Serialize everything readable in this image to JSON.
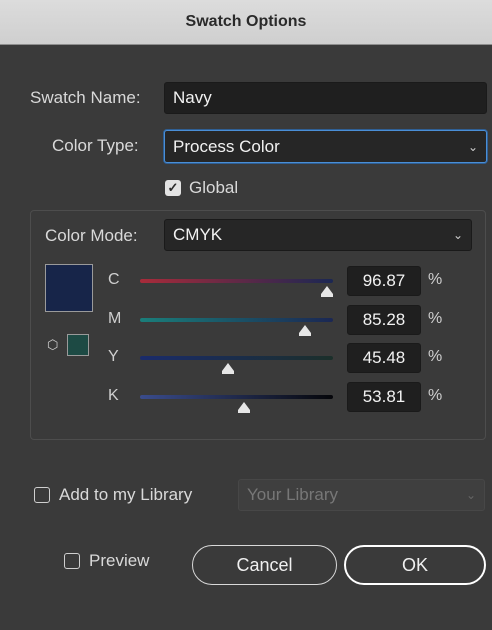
{
  "window": {
    "title": "Swatch Options"
  },
  "swatch_name": {
    "label": "Swatch Name:",
    "value": "Navy"
  },
  "color_type": {
    "label": "Color Type:",
    "selected": "Process Color"
  },
  "global": {
    "label": "Global",
    "checked": true
  },
  "color_mode": {
    "label": "Color Mode:",
    "selected": "CMYK"
  },
  "swatch_preview": {
    "color": "#172549",
    "out_of_gamut_color": "#1d4a44"
  },
  "channels": [
    {
      "letter": "C",
      "value": "96.87",
      "unit": "%",
      "level": 96.87,
      "gradient": [
        "#a82b3a",
        "#1b2753"
      ]
    },
    {
      "letter": "M",
      "value": "85.28",
      "unit": "%",
      "level": 85.28,
      "gradient": [
        "#1a7e7a",
        "#1b2753"
      ]
    },
    {
      "letter": "Y",
      "value": "45.48",
      "unit": "%",
      "level": 45.48,
      "gradient": [
        "#1a2b6b",
        "#1b2f2a"
      ]
    },
    {
      "letter": "K",
      "value": "53.81",
      "unit": "%",
      "level": 53.81,
      "gradient": [
        "#3a4c8c",
        "#05060a"
      ]
    }
  ],
  "library": {
    "label": "Add to my Library",
    "checked": false,
    "select_placeholder": "Your Library"
  },
  "preview": {
    "label": "Preview",
    "checked": false
  },
  "buttons": {
    "cancel": "Cancel",
    "ok": "OK"
  }
}
